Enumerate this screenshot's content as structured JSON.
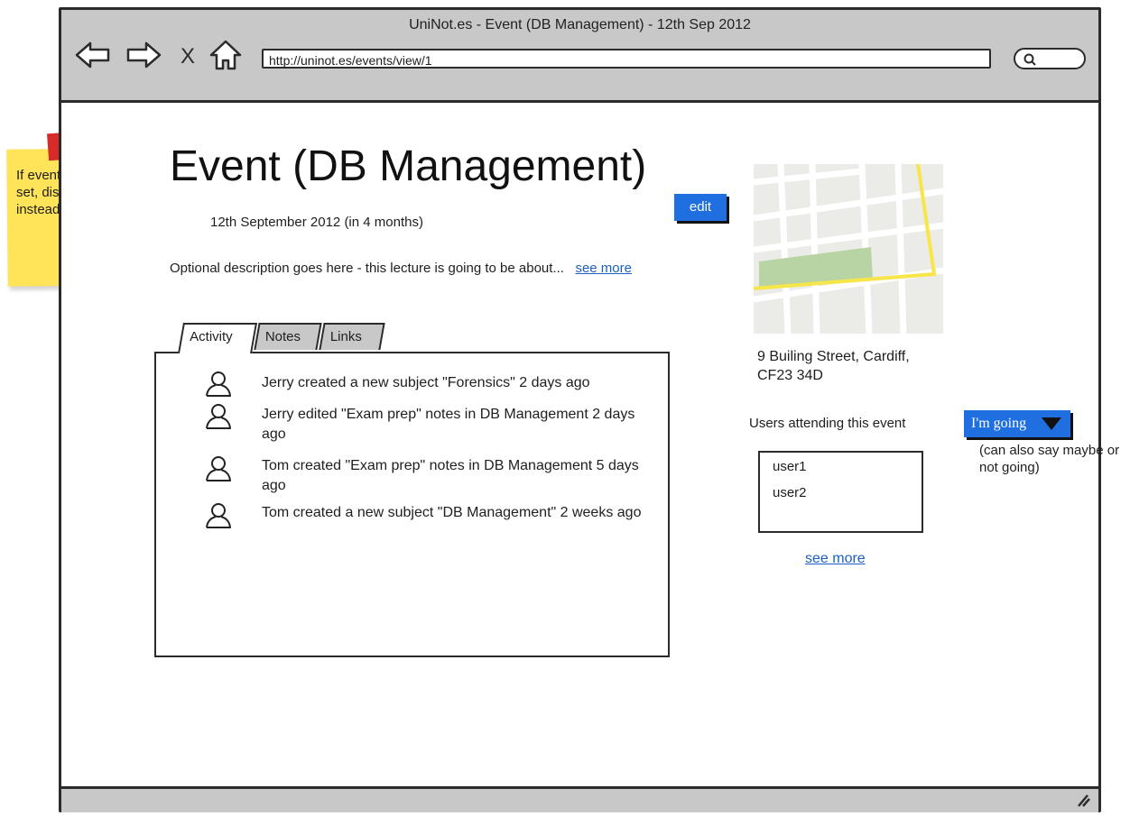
{
  "window": {
    "title": "UniNot.es - Event (DB Management) - 12th Sep 2012",
    "url": "http://uninot.es/events/view/1",
    "close_glyph": "X"
  },
  "sticky_note": {
    "text": "If event has a title set, display that instead",
    "color": "#ffe359",
    "tape_color": "#d92a2a"
  },
  "event": {
    "title": "Event (DB Management)",
    "edit_label": "edit",
    "date": "12th September 2012 (in 4 months)",
    "description": "Optional description goes here - this lecture is going to be about...",
    "see_more": "see more"
  },
  "tabs": [
    {
      "label": "Activity",
      "active": true
    },
    {
      "label": "Notes",
      "active": false
    },
    {
      "label": "Links",
      "active": false
    }
  ],
  "activity": [
    {
      "text": "Jerry created a new subject \"Forensics\" 2 days ago",
      "icon": "user-icon"
    },
    {
      "text": "Jerry edited \"Exam prep\" notes in DB Management 2 days ago",
      "icon": "user-icon"
    },
    {
      "text": "Tom created \"Exam prep\" notes in DB Management 5 days ago",
      "icon": "user-icon"
    },
    {
      "text": "Tom created a new subject \"DB Management\" 2 weeks ago",
      "icon": "user-icon"
    }
  ],
  "location": {
    "address_line1": "9 Builing Street, Cardiff,",
    "address_line2": "CF23 34D"
  },
  "attendance": {
    "label": "Users attending this event",
    "going_label": "I'm going",
    "going_note": "(can also say maybe or not going)",
    "users": [
      "user1",
      "user2"
    ],
    "see_more": "see more"
  },
  "colors": {
    "accent": "#1f6fe0",
    "chrome": "#c8c8c8",
    "link": "#1d5fc1"
  }
}
